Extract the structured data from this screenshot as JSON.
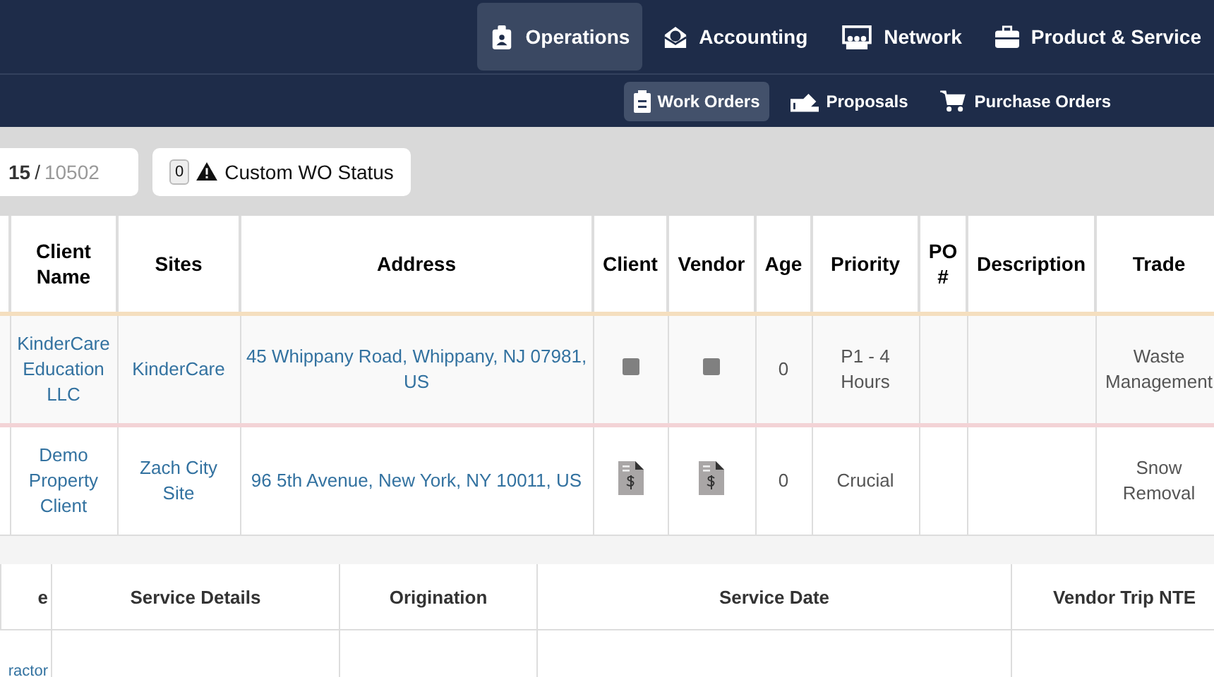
{
  "top_nav": [
    {
      "label": "Operations",
      "selected": true
    },
    {
      "label": "Accounting",
      "selected": false
    },
    {
      "label": "Network",
      "selected": false
    },
    {
      "label": "Product & Service",
      "selected": false
    }
  ],
  "sub_nav": [
    {
      "label": "Work Orders",
      "selected": true
    },
    {
      "label": "Proposals",
      "selected": false
    },
    {
      "label": "Purchase Orders",
      "selected": false
    }
  ],
  "counter": {
    "shown": "15",
    "separator": "/",
    "total": "10502"
  },
  "status_filter": {
    "count": "0",
    "label": "Custom WO Status"
  },
  "table": {
    "columns": [
      "",
      "Client Name",
      "Sites",
      "Address",
      "Client",
      "Vendor",
      "Age",
      "Priority",
      "PO #",
      "Description",
      "Trade"
    ],
    "rows": [
      {
        "color": "#f5dfbf",
        "client_name": "KinderCare Education LLC",
        "site": "KinderCare",
        "address": "45 Whippany Road, Whippany, NJ 07981, US",
        "kind": "square",
        "age": "0",
        "priority": "P1 - 4 Hours",
        "trade": "Waste Management"
      },
      {
        "color": "#f3d3d6",
        "client_name": "Demo Property Client",
        "site": "Zach City Site",
        "address": "96 5th Avenue, New York, NY 10011, US",
        "kind": "invoice",
        "age": "0",
        "priority": "Crucial",
        "trade": "Snow Removal"
      }
    ]
  },
  "table_2": {
    "columns": [
      "e",
      "Service Details",
      "Origination",
      "Service Date",
      "Vendor Trip NTE"
    ],
    "rows": [
      {
        "column_1": "ractor"
      }
    ]
  }
}
